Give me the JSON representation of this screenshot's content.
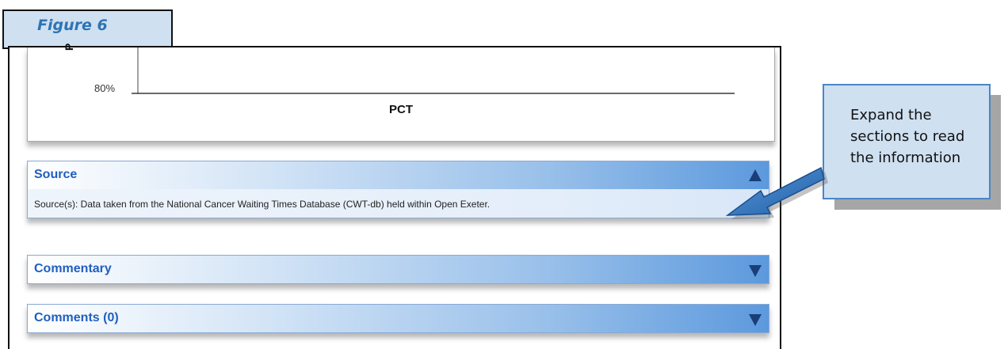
{
  "figure_label": "Figure 6",
  "chart": {
    "y_axis_label": "P",
    "y_tick": "80%",
    "x_axis_label": "PCT"
  },
  "sections": {
    "source": {
      "title": "Source",
      "state": "expanded",
      "text": "Source(s): Data taken from the National Cancer Waiting Times Database (CWT-db) held within Open Exeter."
    },
    "commentary": {
      "title": "Commentary",
      "state": "collapsed"
    },
    "comments": {
      "title": "Comments (0)",
      "state": "collapsed"
    }
  },
  "callout": {
    "line1": "Expand the",
    "line2": "sections to read",
    "line3": "the information"
  },
  "icons": {
    "expanded_caret": "caret-up-icon",
    "collapsed_caret": "caret-down-icon",
    "pointer": "arrow-icon"
  },
  "colors": {
    "header_accent": "#5c99dd",
    "title_blue": "#1f5fbf",
    "caret": "#1a3e78",
    "callout_fill": "#cfe0f1",
    "callout_border": "#4a86c5"
  }
}
